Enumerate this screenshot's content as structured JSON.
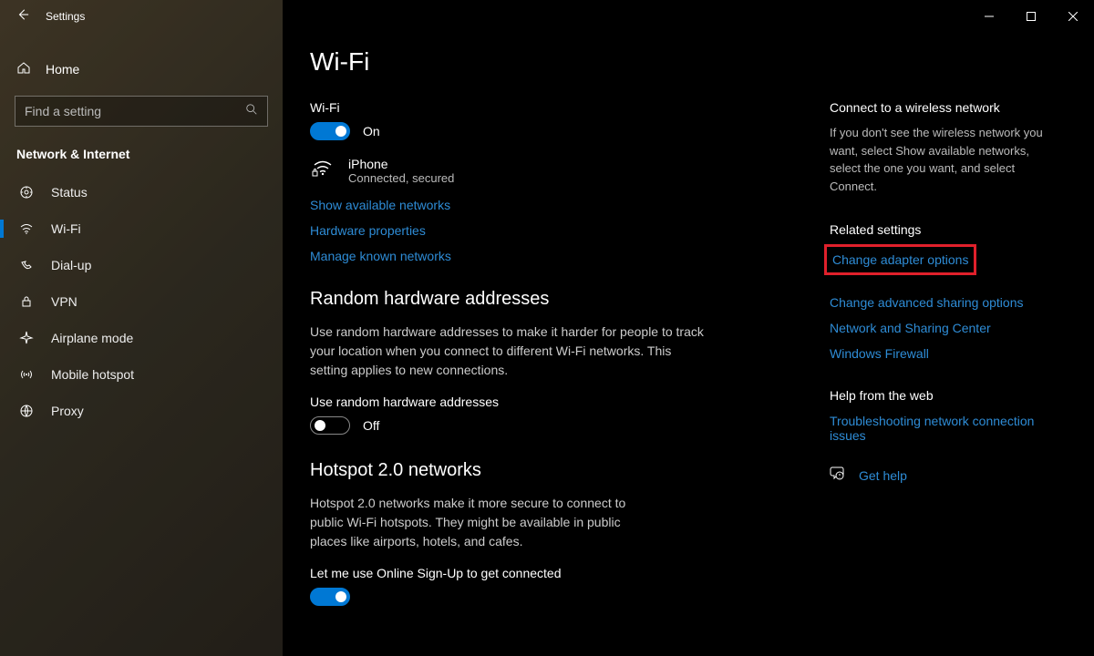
{
  "window": {
    "title": "Settings"
  },
  "sidebar": {
    "home": "Home",
    "search_placeholder": "Find a setting",
    "category": "Network & Internet",
    "items": [
      {
        "label": "Status"
      },
      {
        "label": "Wi-Fi"
      },
      {
        "label": "Dial-up"
      },
      {
        "label": "VPN"
      },
      {
        "label": "Airplane mode"
      },
      {
        "label": "Mobile hotspot"
      },
      {
        "label": "Proxy"
      }
    ]
  },
  "page": {
    "title": "Wi-Fi",
    "wifi_label": "Wi-Fi",
    "wifi_state": "On",
    "network": {
      "name": "iPhone",
      "status": "Connected, secured"
    },
    "links": {
      "show_networks": "Show available networks",
      "hw_props": "Hardware properties",
      "known": "Manage known networks"
    },
    "random": {
      "heading": "Random hardware addresses",
      "desc": "Use random hardware addresses to make it harder for people to track your location when you connect to different Wi-Fi networks. This setting applies to new connections.",
      "toggle_label": "Use random hardware addresses",
      "toggle_state": "Off"
    },
    "hotspot": {
      "heading": "Hotspot 2.0 networks",
      "desc": "Hotspot 2.0 networks make it more secure to connect to public Wi-Fi hotspots. They might be available in public places like airports, hotels, and cafes.",
      "toggle_label": "Let me use Online Sign-Up to get connected"
    }
  },
  "right": {
    "connect_head": "Connect to a wireless network",
    "connect_text": "If you don't see the wireless network you want, select Show available networks, select the one you want, and select Connect.",
    "related_head": "Related settings",
    "related": {
      "adapter": "Change adapter options",
      "sharing": "Change advanced sharing options",
      "center": "Network and Sharing Center",
      "firewall": "Windows Firewall"
    },
    "help_head": "Help from the web",
    "help_link": "Troubleshooting network connection issues",
    "get_help": "Get help"
  }
}
